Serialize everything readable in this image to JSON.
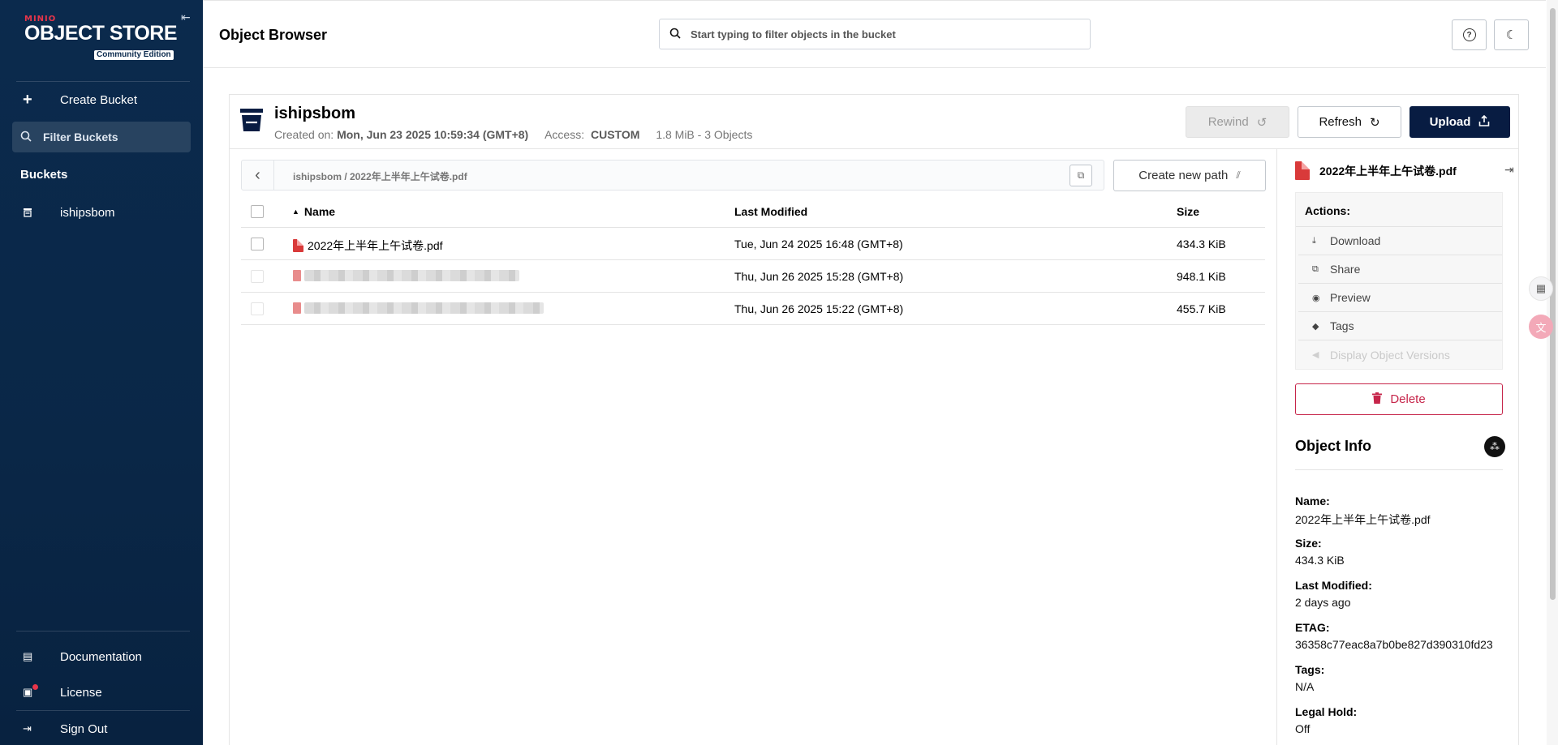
{
  "sidebar": {
    "brand_small": "MINIO",
    "brand_main": "OBJECT STORE",
    "edition": "Community Edition",
    "create_bucket": "Create Bucket",
    "filter_placeholder": "Filter Buckets",
    "buckets_heading": "Buckets",
    "buckets": [
      "ishipsbom"
    ],
    "documentation": "Documentation",
    "license": "License",
    "sign_out": "Sign Out"
  },
  "header": {
    "title": "Object Browser",
    "search_placeholder": "Start typing to filter objects in the bucket"
  },
  "bucket": {
    "name": "ishipsbom",
    "created_label": "Created on:",
    "created_value": "Mon, Jun 23 2025 10:59:34 (GMT+8)",
    "access_label": "Access:",
    "access_value": "CUSTOM",
    "summary": "1.8 MiB - 3 Objects",
    "rewind": "Rewind",
    "refresh": "Refresh",
    "upload": "Upload"
  },
  "breadcrumb": {
    "path": "ishipsbom  /  2022年上半年上午试卷.pdf",
    "create_new_path": "Create new path"
  },
  "table": {
    "headers": {
      "name": "Name",
      "modified": "Last Modified",
      "size": "Size"
    },
    "rows": [
      {
        "name": "2022年上半年上午试卷.pdf",
        "modified": "Tue, Jun 24 2025 16:48 (GMT+8)",
        "size": "434.3 KiB"
      },
      {
        "name": "",
        "modified": "Thu, Jun 26 2025 15:28 (GMT+8)",
        "size": "948.1 KiB"
      },
      {
        "name": "",
        "modified": "Thu, Jun 26 2025 15:22 (GMT+8)",
        "size": "455.7 KiB"
      }
    ]
  },
  "details": {
    "file_name": "2022年上半年上午试卷.pdf",
    "actions_label": "Actions:",
    "actions": [
      "Download",
      "Share",
      "Preview",
      "Tags",
      "Display Object Versions"
    ],
    "delete": "Delete",
    "object_info_title": "Object Info",
    "fields": [
      {
        "key": "Name:",
        "value": "2022年上半年上午试卷.pdf"
      },
      {
        "key": "Size:",
        "value": "434.3 KiB"
      },
      {
        "key": "Last Modified:",
        "value": "2 days ago"
      },
      {
        "key": "ETAG:",
        "value": "36358c77eac8a7b0be827d390310fd23"
      },
      {
        "key": "Tags:",
        "value": "N/A"
      },
      {
        "key": "Legal Hold:",
        "value": "Off"
      }
    ]
  },
  "colors": {
    "sidebar_bg": "#0b2a4d",
    "upload_bg": "#081c42",
    "delete": "#c6254a",
    "pdf": "#d93a3a"
  }
}
